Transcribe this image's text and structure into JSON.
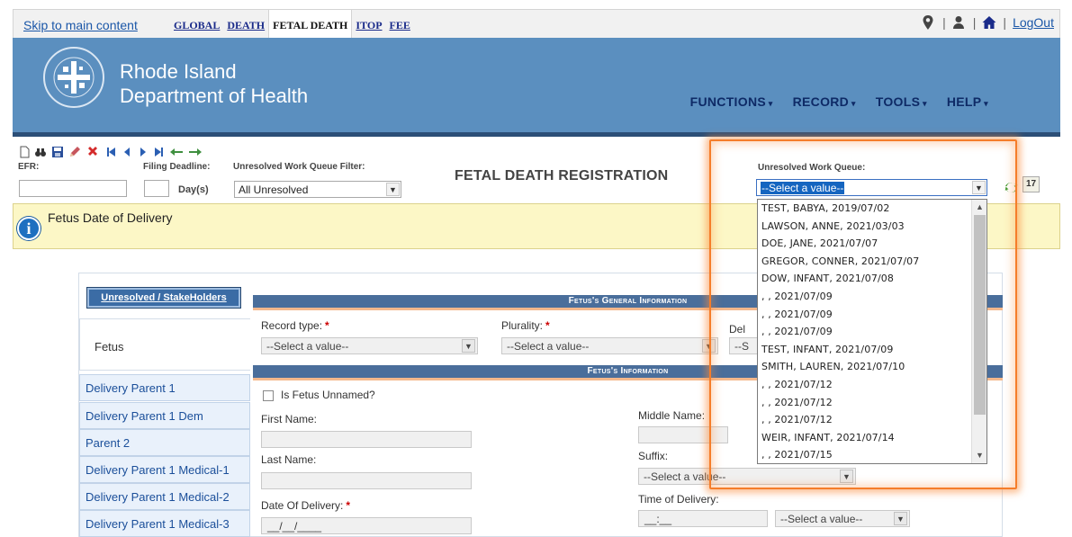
{
  "topbar": {
    "skip_link": "Skip to main content",
    "tabs": [
      "GLOBAL",
      "DEATH",
      "FETAL DEATH",
      "ITOP",
      "FEE"
    ],
    "active_tab": "FETAL DEATH",
    "logout": "LogOut",
    "icons": [
      "map-marker-icon",
      "user-icon",
      "home-icon"
    ]
  },
  "banner": {
    "org_line1": "Rhode Island",
    "org_line2": "Department of Health",
    "menu": [
      "FUNCTIONS",
      "RECORD",
      "TOOLS",
      "HELP"
    ]
  },
  "toolbar": {
    "efr_label": "EFR:",
    "filing_deadline_label": "Filing Deadline:",
    "days_label": "Day(s)",
    "filter_label": "Unresolved Work Queue Filter:",
    "filter_value": "All Unresolved",
    "page_title": "FETAL DEATH REGISTRATION",
    "queue_label": "Unresolved Work Queue:",
    "queue_value": "--Select a value--",
    "queue_count": "17"
  },
  "info": {
    "title": "Fetus Date of Delivery"
  },
  "sidebar": {
    "stakeholders_button": "Unresolved / StakeHolders",
    "active_item": "Fetus",
    "items": [
      "Delivery Parent 1",
      "Delivery Parent 1 Dem",
      "Parent 2",
      "Delivery Parent 1 Medical-1",
      "Delivery Parent 1 Medical-2",
      "Delivery Parent 1 Medical-3"
    ]
  },
  "form": {
    "section1": "Fetus's General Information",
    "record_type_label": "Record type:",
    "record_type_value": "--Select a value--",
    "plurality_label": "Plurality:",
    "plurality_value": "--Select a value--",
    "del_label_partial": "Del",
    "del_value_partial": "--S",
    "section2": "Fetus's Information",
    "unnamed_label": "Is Fetus Unnamed?",
    "first_name_label": "First Name:",
    "middle_name_label": "Middle Name:",
    "last_name_label": "Last Name:",
    "suffix_label": "Suffix:",
    "suffix_value": "--Select a value--",
    "date_label": "Date Of Delivery:",
    "date_value": "__/__/____",
    "time_label": "Time of Delivery:",
    "time_value": "__:__",
    "time_ampm_value": "--Select a value--",
    "required_mark": "*"
  },
  "dropdown": {
    "options": [
      "TEST, BABYA, 2019/07/02",
      "LAWSON, ANNE, 2021/03/03",
      "DOE, JANE, 2021/07/07",
      "GREGOR, CONNER, 2021/07/07",
      "DOW, INFANT, 2021/07/08",
      ", , 2021/07/09",
      ", , 2021/07/09",
      ", , 2021/07/09",
      "TEST, INFANT, 2021/07/09",
      "SMITH, LAUREN, 2021/07/10",
      ", , 2021/07/12",
      ", , 2021/07/12",
      ", , 2021/07/12",
      "WEIR, INFANT, 2021/07/14",
      ", , 2021/07/15"
    ]
  },
  "colors": {
    "banner": "#5b8fbf",
    "menu_text": "#0e2a66",
    "highlight": "#f57d2a",
    "info_bg": "#fcf7c6",
    "section_header": "#4a6e9b"
  }
}
